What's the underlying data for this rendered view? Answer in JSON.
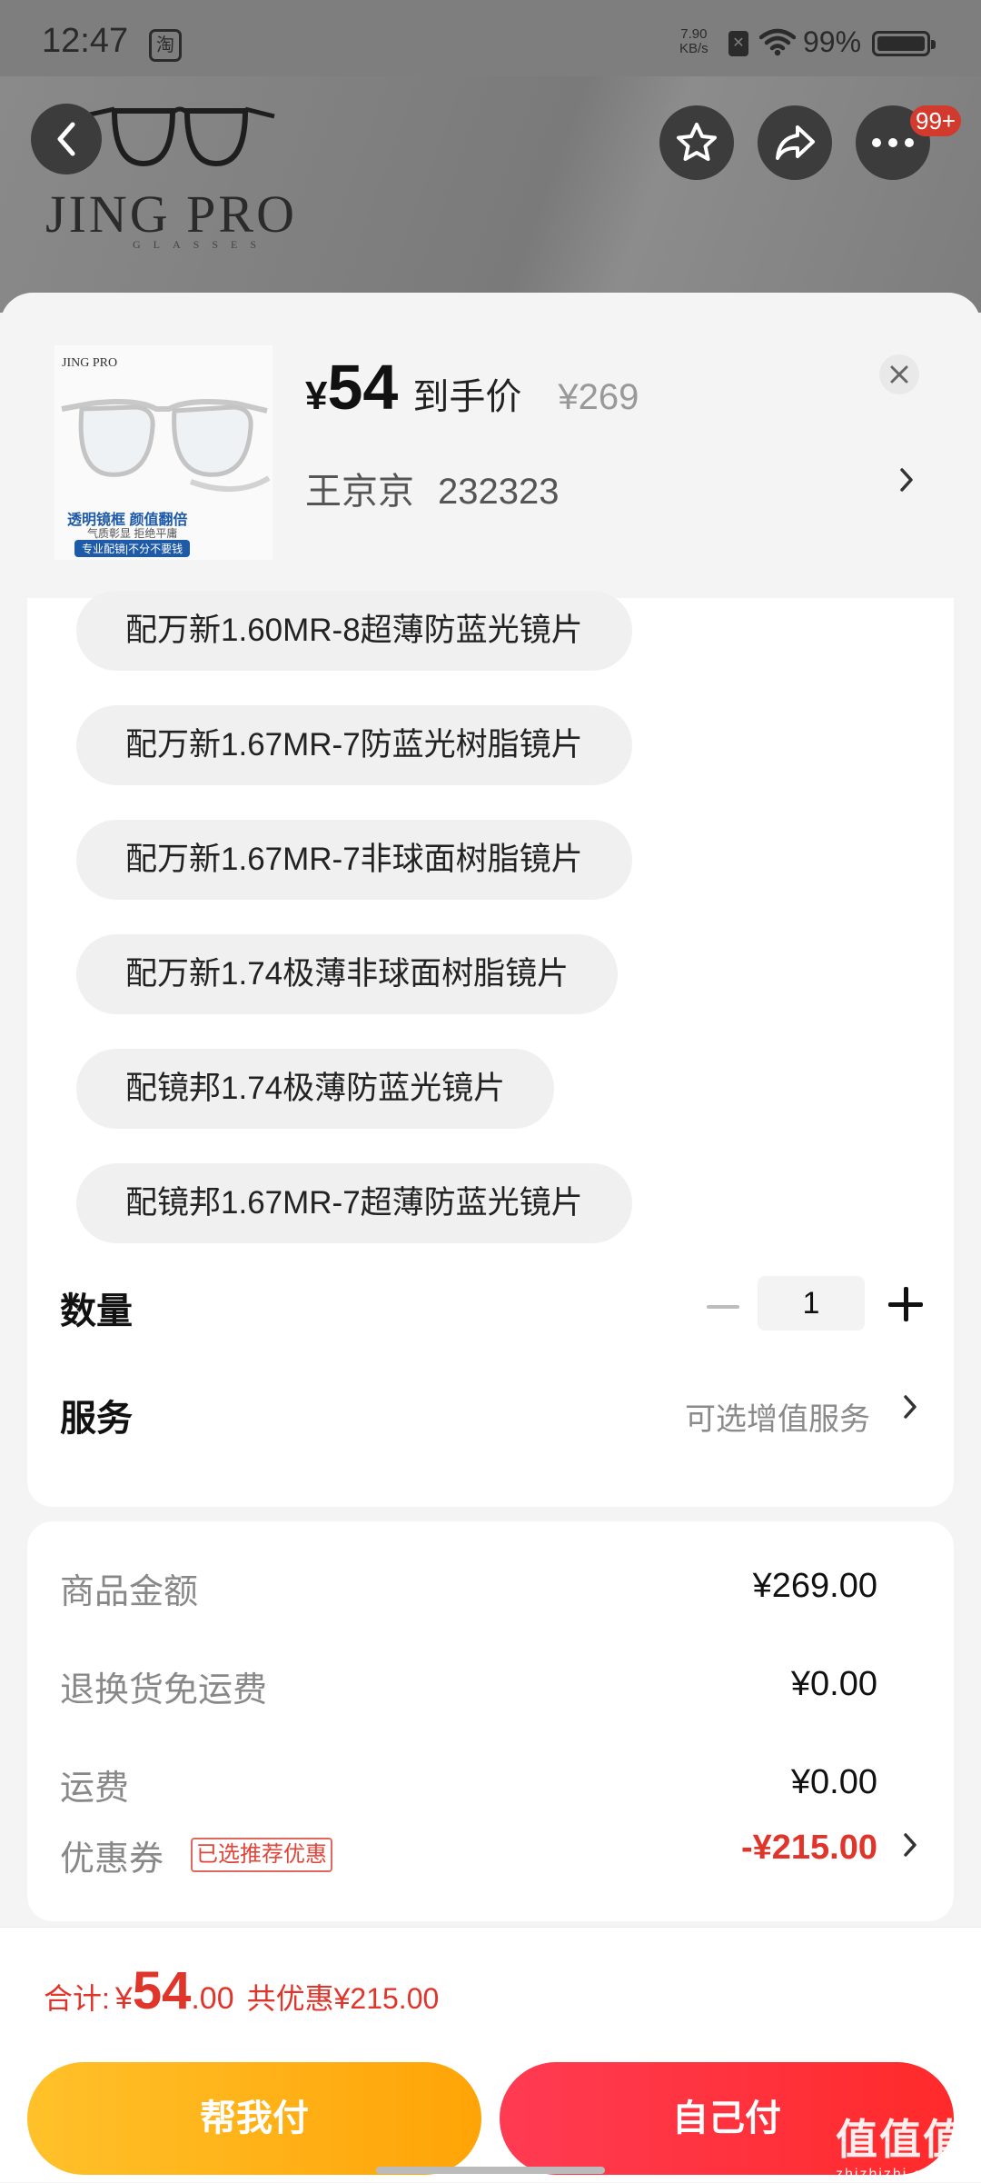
{
  "status_bar": {
    "time": "12:47",
    "app_icon_label": "淘",
    "net_speed_value": "7.90",
    "net_speed_unit": "KB/s",
    "battery_percent": "99%"
  },
  "header": {
    "brand": "JING PRO",
    "tagline": "GLASSES",
    "cart_badge": "99+"
  },
  "sku": {
    "thumb_brand": "JING PRO",
    "thumb_line1": "透明镜框 颜值翻倍",
    "thumb_line2": "气质彰显 拒绝平庸",
    "thumb_line3": "专业配镜|不分不要钱",
    "price_currency": "¥",
    "price_value": "54",
    "price_label": "到手价",
    "original_price": "¥269",
    "recipient": "王京京",
    "recipient_id": "232323"
  },
  "options": [
    "配万新1.60MR-8超薄防蓝光镜片",
    "配万新1.67MR-7防蓝光树脂镜片",
    "配万新1.67MR-7非球面树脂镜片",
    "配万新1.74极薄非球面树脂镜片",
    "配镜邦1.74极薄防蓝光镜片",
    "配镜邦1.67MR-7超薄防蓝光镜片"
  ],
  "quantity": {
    "label": "数量",
    "value": "1"
  },
  "service": {
    "label": "服务",
    "hint": "可选增值服务"
  },
  "fees": {
    "goods_label": "商品金额",
    "goods_value": "¥269.00",
    "return_label": "退换货免运费",
    "return_value": "¥0.00",
    "shipping_label": "运费",
    "shipping_value": "¥0.00",
    "coupon_label": "优惠券",
    "coupon_tag": "已选推荐优惠",
    "coupon_value": "-¥215.00"
  },
  "total": {
    "label": "合计:",
    "currency": "¥",
    "integer": "54",
    "decimal": ".00",
    "discount": "共优惠¥215.00"
  },
  "buttons": {
    "help_pay": "帮我付",
    "self_pay": "自己付"
  },
  "watermark": {
    "main": "值值值",
    "sub": "zhizhizhi.com"
  },
  "colors": {
    "accent_red": "#e0352b",
    "help_btn": "#ffb412",
    "self_btn": "#ff3040"
  }
}
